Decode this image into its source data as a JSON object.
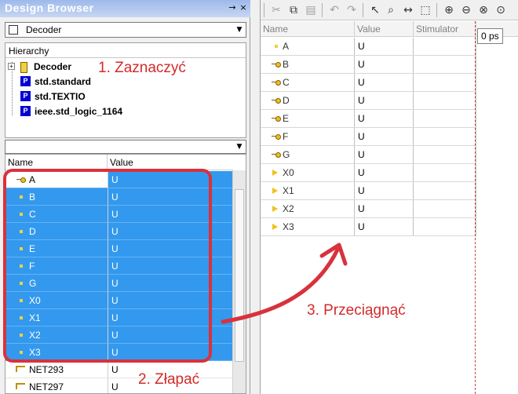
{
  "left_panel": {
    "title": "Design Browser",
    "pin_symbol": "→",
    "close_symbol": "×",
    "design_combo": "Decoder",
    "hierarchy": {
      "header": "Hierarchy",
      "items": [
        {
          "label": "Decoder",
          "kind": "module",
          "expandable": true
        },
        {
          "label": "std.standard",
          "kind": "package"
        },
        {
          "label": "std.TEXTIO",
          "kind": "package"
        },
        {
          "label": "ieee.std_logic_1164",
          "kind": "package"
        }
      ],
      "package_letter": "P",
      "expand_symbol": "+"
    },
    "filter_combo": "",
    "signals": {
      "col_name": "Name",
      "col_value": "Value",
      "rows": [
        {
          "name": "A",
          "value": "U",
          "kind": "in",
          "selected": true
        },
        {
          "name": "B",
          "value": "U",
          "kind": "in-dot",
          "selected": true
        },
        {
          "name": "C",
          "value": "U",
          "kind": "in-dot",
          "selected": true
        },
        {
          "name": "D",
          "value": "U",
          "kind": "in-dot",
          "selected": true
        },
        {
          "name": "E",
          "value": "U",
          "kind": "in-dot",
          "selected": true
        },
        {
          "name": "F",
          "value": "U",
          "kind": "in-dot",
          "selected": true
        },
        {
          "name": "G",
          "value": "U",
          "kind": "in-dot",
          "selected": true
        },
        {
          "name": "X0",
          "value": "U",
          "kind": "in-dot",
          "selected": true
        },
        {
          "name": "X1",
          "value": "U",
          "kind": "in-dot",
          "selected": true
        },
        {
          "name": "X2",
          "value": "U",
          "kind": "in-dot",
          "selected": true
        },
        {
          "name": "X3",
          "value": "U",
          "kind": "in-dot",
          "selected": true
        },
        {
          "name": "NET293",
          "value": "U",
          "kind": "net",
          "selected": false
        },
        {
          "name": "NET297",
          "value": "U",
          "kind": "net",
          "selected": false
        }
      ]
    }
  },
  "waveform": {
    "col_name": "Name",
    "col_value": "Value",
    "col_stimulator": "Stimulator",
    "time_cursor": "0 ps",
    "rows": [
      {
        "name": "A",
        "value": "U",
        "kind": "dot"
      },
      {
        "name": "B",
        "value": "U",
        "kind": "in"
      },
      {
        "name": "C",
        "value": "U",
        "kind": "in"
      },
      {
        "name": "D",
        "value": "U",
        "kind": "in"
      },
      {
        "name": "E",
        "value": "U",
        "kind": "in"
      },
      {
        "name": "F",
        "value": "U",
        "kind": "in"
      },
      {
        "name": "G",
        "value": "U",
        "kind": "in"
      },
      {
        "name": "X0",
        "value": "U",
        "kind": "out"
      },
      {
        "name": "X1",
        "value": "U",
        "kind": "out"
      },
      {
        "name": "X2",
        "value": "U",
        "kind": "out"
      },
      {
        "name": "X3",
        "value": "U",
        "kind": "out"
      }
    ]
  },
  "toolbar": {
    "tools": [
      "cut",
      "copy",
      "paste",
      "undo",
      "redo",
      "select",
      "zoom",
      "measure",
      "pointer-select",
      "zoom-in",
      "zoom-out",
      "zoom-fit",
      "zoom-reset"
    ]
  },
  "annotations": {
    "step1": "1. Zaznaczyć",
    "step2": "2. Złapać",
    "step3": "3. Przeciągnąć"
  },
  "colors": {
    "selection": "#3399ee",
    "annotation": "#d8323c",
    "time_cursor": "#c04040"
  }
}
